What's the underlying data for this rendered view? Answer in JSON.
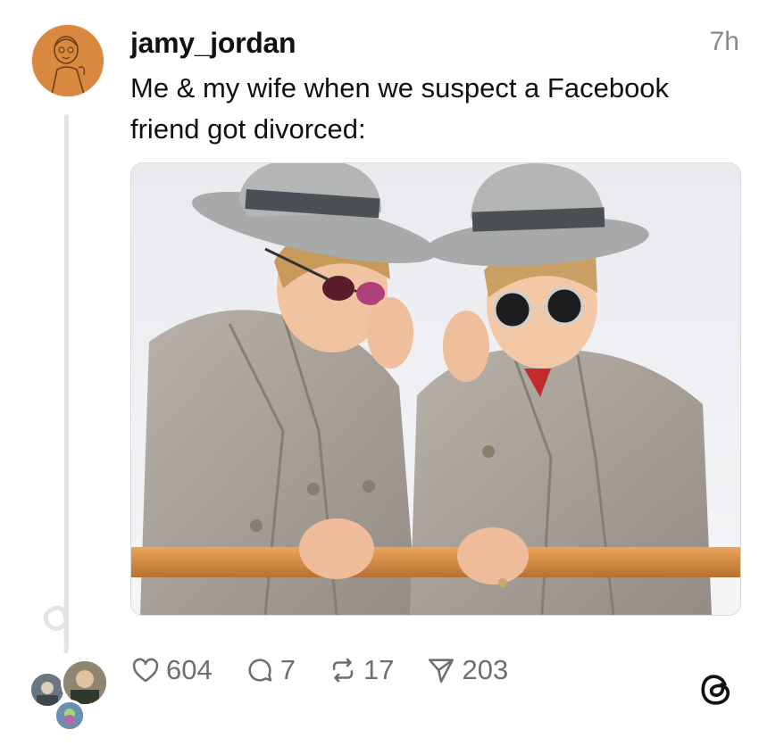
{
  "post": {
    "username": "jamy_jordan",
    "timestamp": "7h",
    "text_lines": [
      "Me & my wife when we suspect a Facebook",
      "friend got divorced:"
    ]
  },
  "actions": {
    "likes": "604",
    "comments": "7",
    "reposts": "17",
    "shares": "203"
  },
  "icons": {
    "like": "heart-icon",
    "comment": "comment-bubble-icon",
    "repost": "repost-icon",
    "share": "send-icon",
    "brand": "threads-logo-icon"
  },
  "colors": {
    "text": "#111111",
    "muted": "#8a8a8a",
    "action": "#6f6f6f",
    "thread_line": "#e4e4e4",
    "avatar_bg": "#d9893f"
  }
}
